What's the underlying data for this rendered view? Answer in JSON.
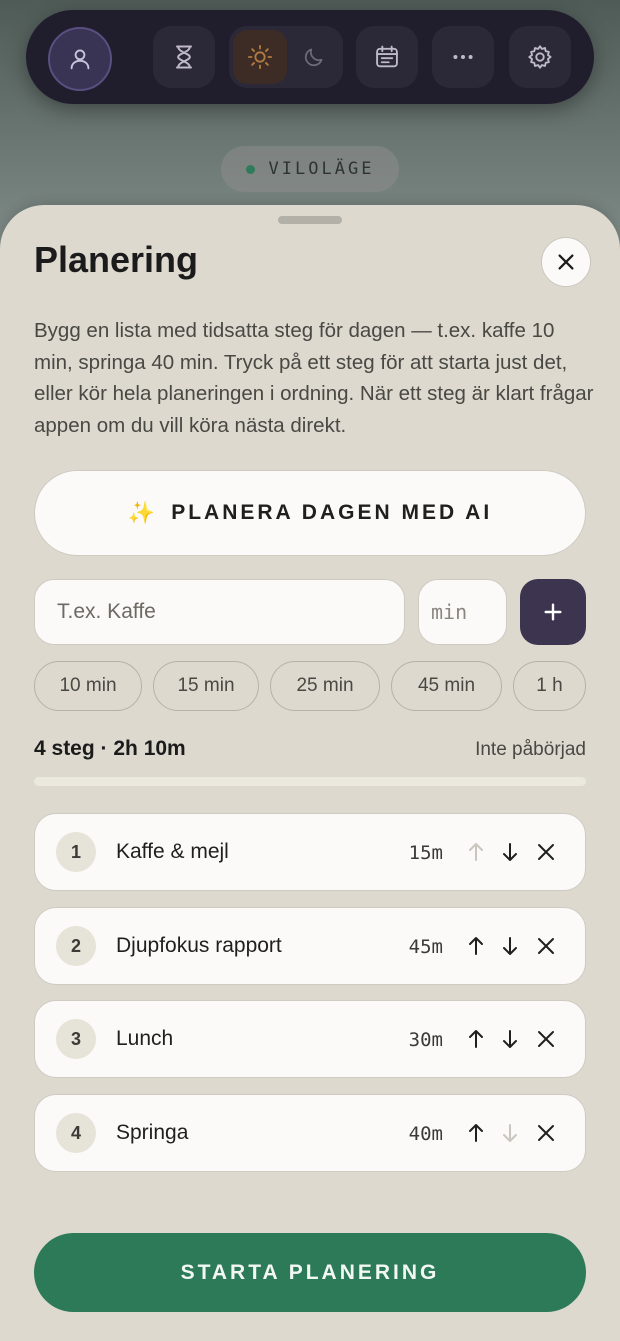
{
  "toolbar": {
    "items": [
      {
        "icon": "user-icon"
      },
      {
        "icon": "hourglass-icon"
      },
      {
        "icon": "sun-icon",
        "active": true
      },
      {
        "icon": "moon-icon"
      },
      {
        "icon": "calendar-icon"
      },
      {
        "icon": "more-icon"
      },
      {
        "icon": "settings-gear-icon"
      }
    ]
  },
  "rest_mode": {
    "label": "VILOLÄGE",
    "dot_color": "#2f7a5a"
  },
  "sheet": {
    "title": "Planering",
    "description": "Bygg en lista med tidsatta steg för dagen — t.ex. kaffe 10 min, springa 40 min. Tryck på ett steg för att starta just det, eller kör hela planeringen i ordning. När ett steg är klart frågar appen om du vill köra nästa direkt.",
    "ai_button": {
      "icon": "sparkles-icon",
      "glyph": "✨",
      "label": "PLANERA DAGEN MED AI"
    },
    "new_step": {
      "name_placeholder": "T.ex. Kaffe",
      "name_value": "",
      "minutes_placeholder": "min",
      "minutes_value": "",
      "add_icon": "plus-icon"
    },
    "duration_chips": [
      "10 min",
      "15 min",
      "25 min",
      "45 min",
      "1 h"
    ],
    "summary": "4 steg · 2h 10m",
    "status": "Inte påbörjad",
    "progress": 0,
    "steps": [
      {
        "number": "1",
        "name": "Kaffe & mejl",
        "duration": "15m",
        "can_move_up": false,
        "can_move_down": true
      },
      {
        "number": "2",
        "name": "Djupfokus rapport",
        "duration": "45m",
        "can_move_up": true,
        "can_move_down": true
      },
      {
        "number": "3",
        "name": "Lunch",
        "duration": "30m",
        "can_move_up": true,
        "can_move_down": true
      },
      {
        "number": "4",
        "name": "Springa",
        "duration": "40m",
        "can_move_up": true,
        "can_move_down": false
      }
    ],
    "start_button": "STARTA PLANERING"
  },
  "colors": {
    "accent_green": "#2d7a58",
    "accent_purple": "#3d3550",
    "sheet_bg": "#ddd9cf",
    "toolbar_bg": "#201d2c"
  }
}
